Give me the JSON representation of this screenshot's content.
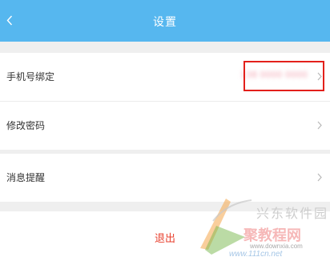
{
  "header": {
    "title": "设置",
    "back_icon": "chevron-left-icon"
  },
  "settings": {
    "phone_binding": {
      "label": "手机号绑定",
      "value": "138 0000 0000"
    },
    "change_password": {
      "label": "修改密码"
    },
    "notifications": {
      "label": "消息提醒"
    }
  },
  "logout": {
    "label": "退出"
  },
  "watermark": {
    "line1": "兴东软件园",
    "line2": "聚教程网",
    "url": "www.downxia.com",
    "url2": "www.111cn.net"
  },
  "colors": {
    "header": "#56b7ef",
    "logout_text": "#e8412f",
    "highlight_border": "#e3201b",
    "background": "#efefef"
  }
}
